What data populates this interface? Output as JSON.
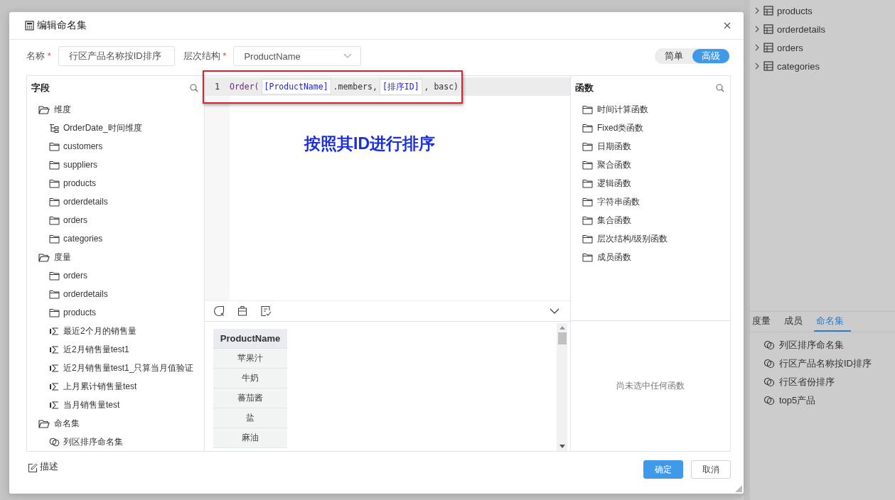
{
  "background": {
    "tree": [
      {
        "label": "products",
        "expanded": false
      },
      {
        "label": "orderdetails",
        "expanded": false
      },
      {
        "label": "orders",
        "expanded": false
      },
      {
        "label": "categories",
        "expanded": false
      }
    ],
    "tabs": [
      {
        "label": "度量",
        "selected": false
      },
      {
        "label": "成员",
        "selected": false
      },
      {
        "label": "命名集",
        "selected": true
      }
    ],
    "named_sets": [
      "列区排序命名集",
      "行区产品名称按ID排序",
      "行区省份排序",
      "top5产品"
    ]
  },
  "dialog": {
    "title": "编辑命名集",
    "form": [
      {
        "label": "名称",
        "mark": "*",
        "kind": "input",
        "value": "行区产品名称按ID排序"
      },
      {
        "label": "层次结构",
        "mark": "*",
        "kind": "select",
        "value": "ProductName"
      }
    ],
    "modes": [
      {
        "label": "简单",
        "selected": false
      },
      {
        "label": "高级",
        "selected": true
      }
    ],
    "fields_panel": {
      "title": "字段",
      "groups": [
        {
          "label": "维度",
          "expanded": true,
          "children": [
            {
              "label": "OrderDate_时间维度",
              "kind": "hierarchy"
            },
            {
              "label": "customers",
              "kind": "folder"
            },
            {
              "label": "suppliers",
              "kind": "folder"
            },
            {
              "label": "products",
              "kind": "folder"
            },
            {
              "label": "orderdetails",
              "kind": "folder"
            },
            {
              "label": "orders",
              "kind": "folder"
            },
            {
              "label": "categories",
              "kind": "folder"
            }
          ]
        },
        {
          "label": "度量",
          "expanded": true,
          "children": [
            {
              "label": "orders",
              "kind": "folder"
            },
            {
              "label": "orderdetails",
              "kind": "folder"
            },
            {
              "label": "products",
              "kind": "folder"
            },
            {
              "label": "最近2个月的销售量",
              "kind": "measure"
            },
            {
              "label": "近2月销售量test1",
              "kind": "measure"
            },
            {
              "label": "近2月销售量test1_只算当月值验证",
              "kind": "measure"
            },
            {
              "label": "上月累计销售量test",
              "kind": "measure"
            },
            {
              "label": "当月销售量test",
              "kind": "measure"
            }
          ]
        },
        {
          "label": "命名集",
          "expanded": true,
          "children": [
            {
              "label": "列区排序命名集",
              "kind": "namedset"
            }
          ]
        }
      ]
    },
    "editor": {
      "line_number": "1",
      "tokens": [
        {
          "text": "Order(",
          "kind": "func"
        },
        {
          "text": "[ProductName]",
          "kind": "ref"
        },
        {
          "text": ".members,",
          "kind": "plain"
        },
        {
          "text": "[排序ID]",
          "kind": "ref"
        },
        {
          "text": ", basc)",
          "kind": "plain"
        }
      ],
      "annotation": "按照其ID进行排序"
    },
    "preview_table": {
      "columns": [
        "ProductName"
      ],
      "rows": [
        "苹果汁",
        "牛奶",
        "蕃茄酱",
        "盐",
        "麻油"
      ]
    },
    "functions_panel": {
      "title": "函数",
      "items": [
        "时间计算函数",
        "Fixed类函数",
        "日期函数",
        "聚合函数",
        "逻辑函数",
        "字符串函数",
        "集合函数",
        "层次结构/级别函数",
        "成员函数"
      ],
      "empty_text": "尚未选中任何函数"
    },
    "footer": {
      "describe": "描述",
      "buttons": [
        {
          "label": "确定",
          "kind": "primary"
        },
        {
          "label": "取消",
          "kind": "default"
        }
      ]
    }
  }
}
